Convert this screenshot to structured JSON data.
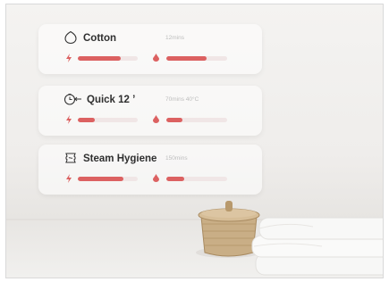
{
  "programs": [
    {
      "name": "Cotton",
      "detail": "12mins",
      "icon": "tshirt-icon",
      "power_fill": 0.72,
      "water_fill": 0.66
    },
    {
      "name": "Quick 12 ’",
      "detail": "70mins  40°C",
      "icon": "timer-icon",
      "power_fill": 0.28,
      "water_fill": 0.26
    },
    {
      "name": "Steam Hygiene",
      "detail": "150mins",
      "icon": "steam-icon",
      "power_fill": 0.76,
      "water_fill": 0.3
    }
  ],
  "colors": {
    "accent": "#dc6161",
    "track": "#f0e6e6"
  }
}
